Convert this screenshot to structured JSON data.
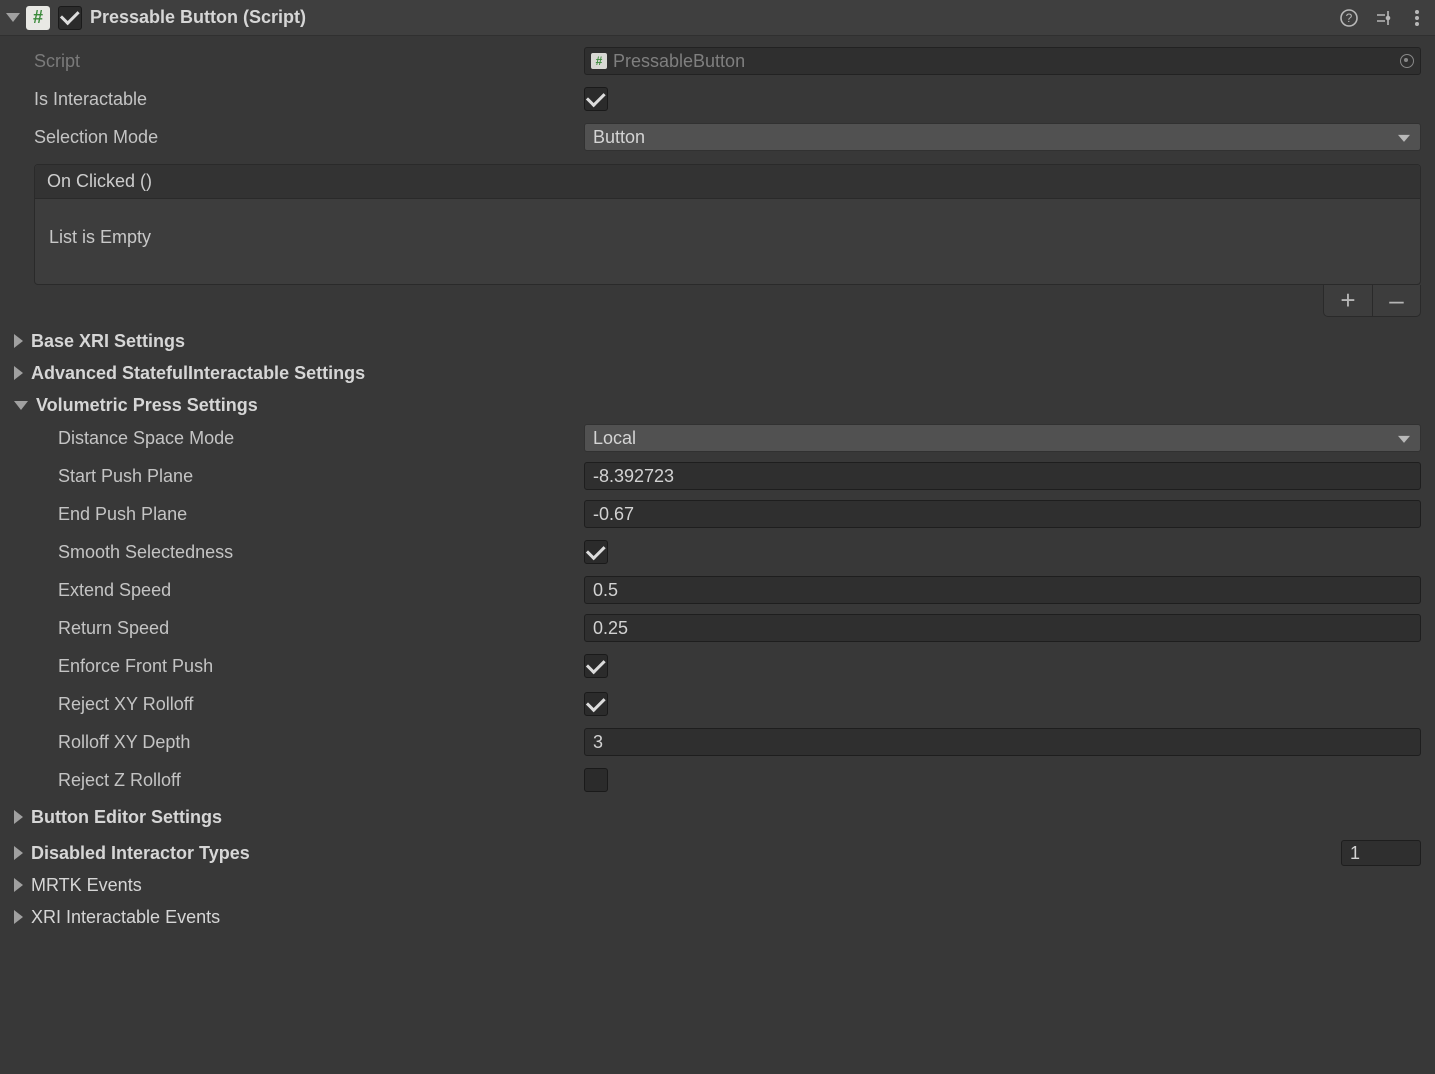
{
  "header": {
    "title": "Pressable Button (Script)",
    "enabled": true
  },
  "fields": {
    "scriptLabel": "Script",
    "scriptValue": "PressableButton",
    "isInteractableLabel": "Is Interactable",
    "isInteractable": true,
    "selectionModeLabel": "Selection Mode",
    "selectionModeValue": "Button"
  },
  "event": {
    "header": "On Clicked ()",
    "empty": "List is Empty",
    "plus": "+",
    "minus": "–"
  },
  "sections": {
    "baseXri": "Base XRI Settings",
    "advanced": "Advanced StatefulInteractable Settings",
    "volumetric": "Volumetric Press Settings",
    "buttonEditor": "Button Editor Settings"
  },
  "volumetric": {
    "distanceSpaceModeLabel": "Distance Space Mode",
    "distanceSpaceMode": "Local",
    "startPushPlaneLabel": "Start Push Plane",
    "startPushPlane": "-8.392723",
    "endPushPlaneLabel": "End Push Plane",
    "endPushPlane": "-0.67",
    "smoothSelectednessLabel": "Smooth Selectedness",
    "smoothSelectedness": true,
    "extendSpeedLabel": "Extend Speed",
    "extendSpeed": "0.5",
    "returnSpeedLabel": "Return Speed",
    "returnSpeed": "0.25",
    "enforceFrontPushLabel": "Enforce Front Push",
    "enforceFrontPush": true,
    "rejectXYRolloffLabel": "Reject XY Rolloff",
    "rejectXYRolloff": true,
    "rolloffXYDepthLabel": "Rolloff XY Depth",
    "rolloffXYDepth": "3",
    "rejectZRolloffLabel": "Reject Z Rolloff",
    "rejectZRolloff": false
  },
  "bottom": {
    "disabledInteractor": "Disabled Interactor Types",
    "disabledInteractorCount": "1",
    "mrtkEvents": "MRTK Events",
    "xriEvents": "XRI Interactable Events"
  }
}
